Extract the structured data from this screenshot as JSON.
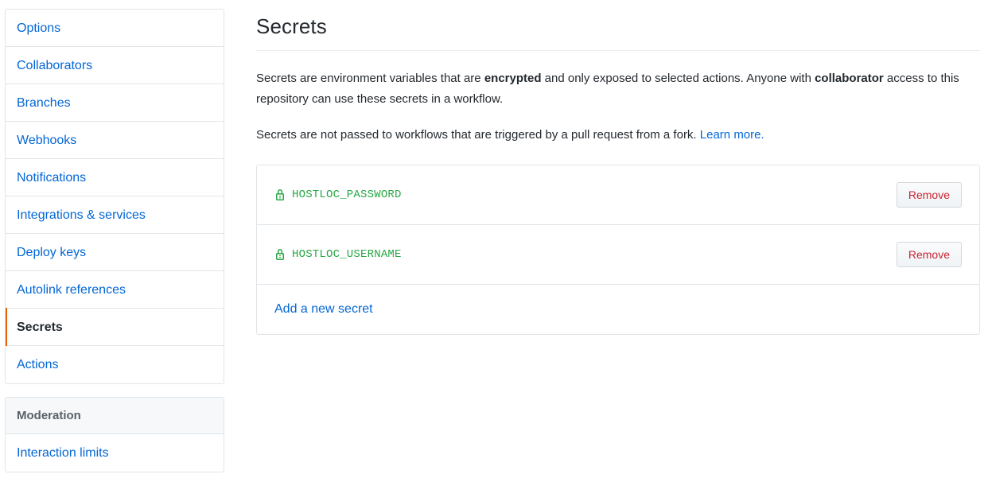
{
  "sidebar": {
    "settings_menu": [
      {
        "label": "Options",
        "selected": false
      },
      {
        "label": "Collaborators",
        "selected": false
      },
      {
        "label": "Branches",
        "selected": false
      },
      {
        "label": "Webhooks",
        "selected": false
      },
      {
        "label": "Notifications",
        "selected": false
      },
      {
        "label": "Integrations & services",
        "selected": false
      },
      {
        "label": "Deploy keys",
        "selected": false
      },
      {
        "label": "Autolink references",
        "selected": false
      },
      {
        "label": "Secrets",
        "selected": true
      },
      {
        "label": "Actions",
        "selected": false
      }
    ],
    "moderation": {
      "header": "Moderation",
      "items": [
        {
          "label": "Interaction limits"
        }
      ]
    },
    "selected_accent_color": "#e36209"
  },
  "main": {
    "title": "Secrets",
    "paragraph_1": {
      "part_1": "Secrets are environment variables that are ",
      "bold_1": "encrypted",
      "part_2": " and only exposed to selected actions. Anyone with ",
      "bold_2": "collaborator",
      "part_3": " access to this repository can use these secrets in a workflow."
    },
    "paragraph_2": {
      "part_1": "Secrets are not passed to workflows that are triggered by a pull request from a fork. ",
      "link_text": "Learn more.",
      "link_color": "#0366d6"
    },
    "secrets": [
      {
        "icon": "lock-icon",
        "name": "HOSTLOC_PASSWORD",
        "action_label": "Remove"
      },
      {
        "icon": "lock-icon",
        "name": "HOSTLOC_USERNAME",
        "action_label": "Remove"
      }
    ],
    "add_secret_label": "Add a new secret",
    "secret_name_color": "#28a745",
    "remove_label_color": "#cb2431"
  }
}
